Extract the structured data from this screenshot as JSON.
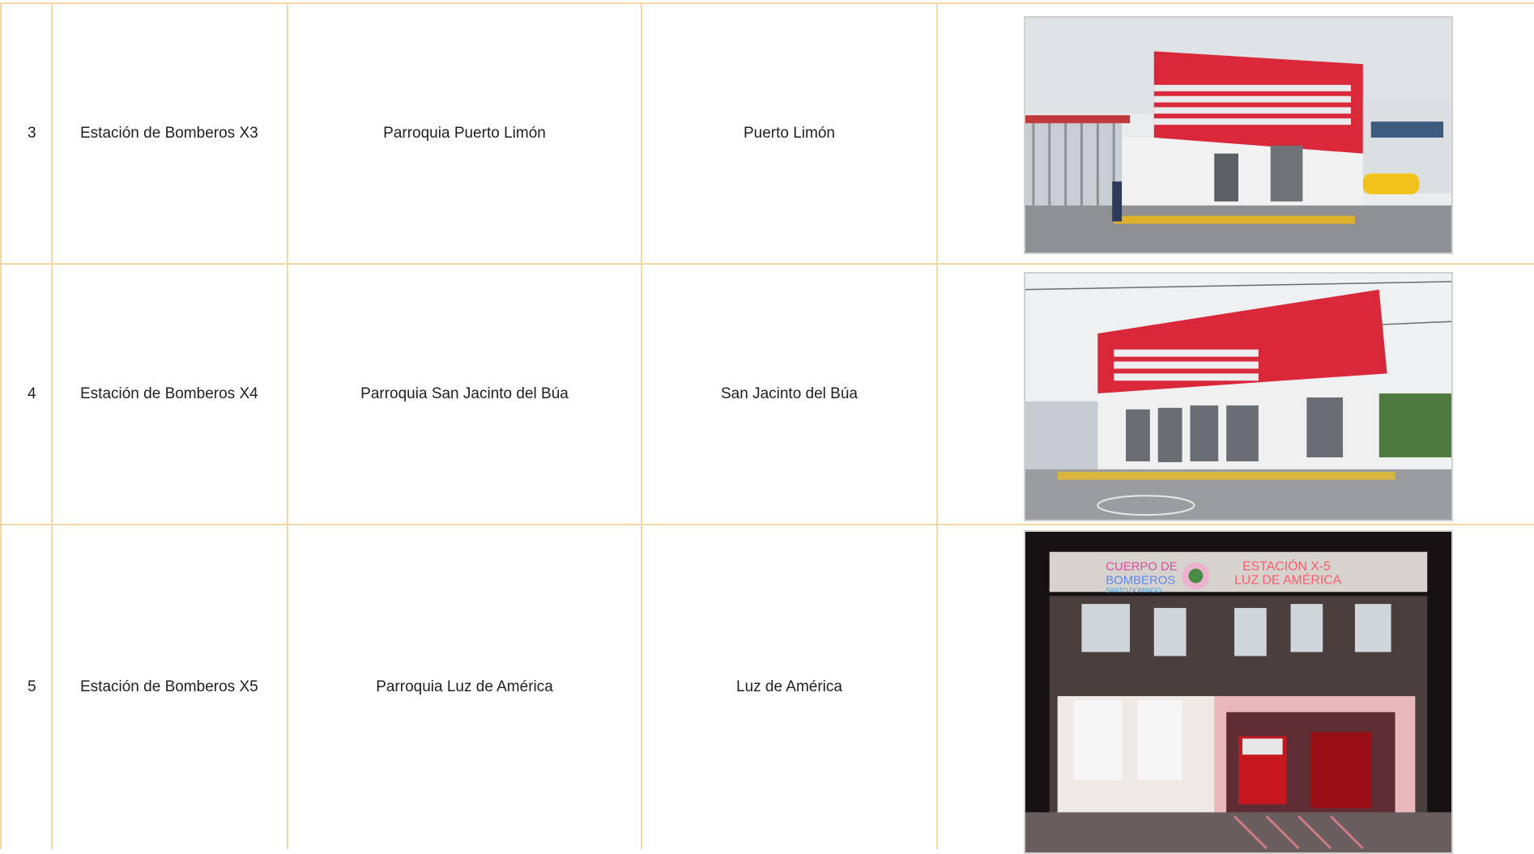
{
  "rows": [
    {
      "number": "3",
      "station": "Estación de Bomberos X3",
      "parish": "Parroquia Puerto Limón",
      "location": "Puerto Limón"
    },
    {
      "number": "4",
      "station": "Estación de Bomberos X4",
      "parish": "Parroquia San Jacinto del Búa",
      "location": "San Jacinto del Búa"
    },
    {
      "number": "5",
      "station": "Estación de Bomberos X5",
      "parish": "Parroquia Luz de América",
      "location": "Luz de América",
      "photo_sign": {
        "left_line1": "CUERPO DE",
        "left_line2": "BOMBEROS",
        "left_line3": "SANTO DOMINGO",
        "right_line1": "ESTACIÓN X-5",
        "right_line2": "LUZ DE AMÉRICA"
      }
    }
  ],
  "colors": {
    "border": "#f3d7a4",
    "station_red": "#d8283a",
    "night_sign_red": "#ff5b6b"
  }
}
